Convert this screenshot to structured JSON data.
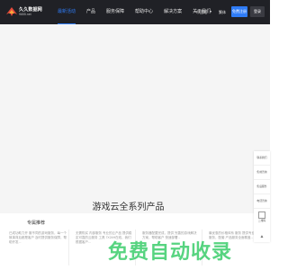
{
  "header": {
    "logo_text": "久久数据网",
    "logo_sub": "9655.net",
    "nav": [
      {
        "label": "最新活动",
        "active": true
      },
      {
        "label": "产品",
        "active": false
      },
      {
        "label": "服务保障",
        "active": false
      },
      {
        "label": "帮助中心",
        "active": false
      },
      {
        "label": "解决方案",
        "active": false
      },
      {
        "label": "关于我们",
        "active": false
      }
    ],
    "region": "中国站",
    "language": "繁体",
    "register": "免费注册",
    "login": "登录"
  },
  "banner": {
    "title": "游戏云全系列产品"
  },
  "cards": [
    {
      "title": "",
      "desc": "已成功助力开 服不同的游戏服务，每一个故事背后都是客户 及时提供服务保障，帮助开发..."
    },
    {
      "title": "",
      "desc": "无需购买 内部服务 专业的云产品 提供稳定可靠的云服务 工具 7X24H在线，我们根据客户..."
    },
    {
      "title": "",
      "desc": "服务器配置完成，提供 完善的游戏解决 方案，帮助客户 快速部署..."
    },
    {
      "title": "",
      "desc": "最优惠的价格体系 服务 提供专业的技术服务，配套 产品服务全面覆盖..."
    }
  ],
  "card_feature_title": "专属推荐",
  "watermark": "免费自动收录",
  "sidebar": {
    "items": [
      "联系我们",
      "售前咨询",
      "售后服务",
      "电话咨询"
    ],
    "qr_label": "二维码",
    "top_label": "▲"
  },
  "colors": {
    "accent": "#2f7cf6",
    "topbar": "#202126",
    "watermark": "#3acd6b"
  }
}
